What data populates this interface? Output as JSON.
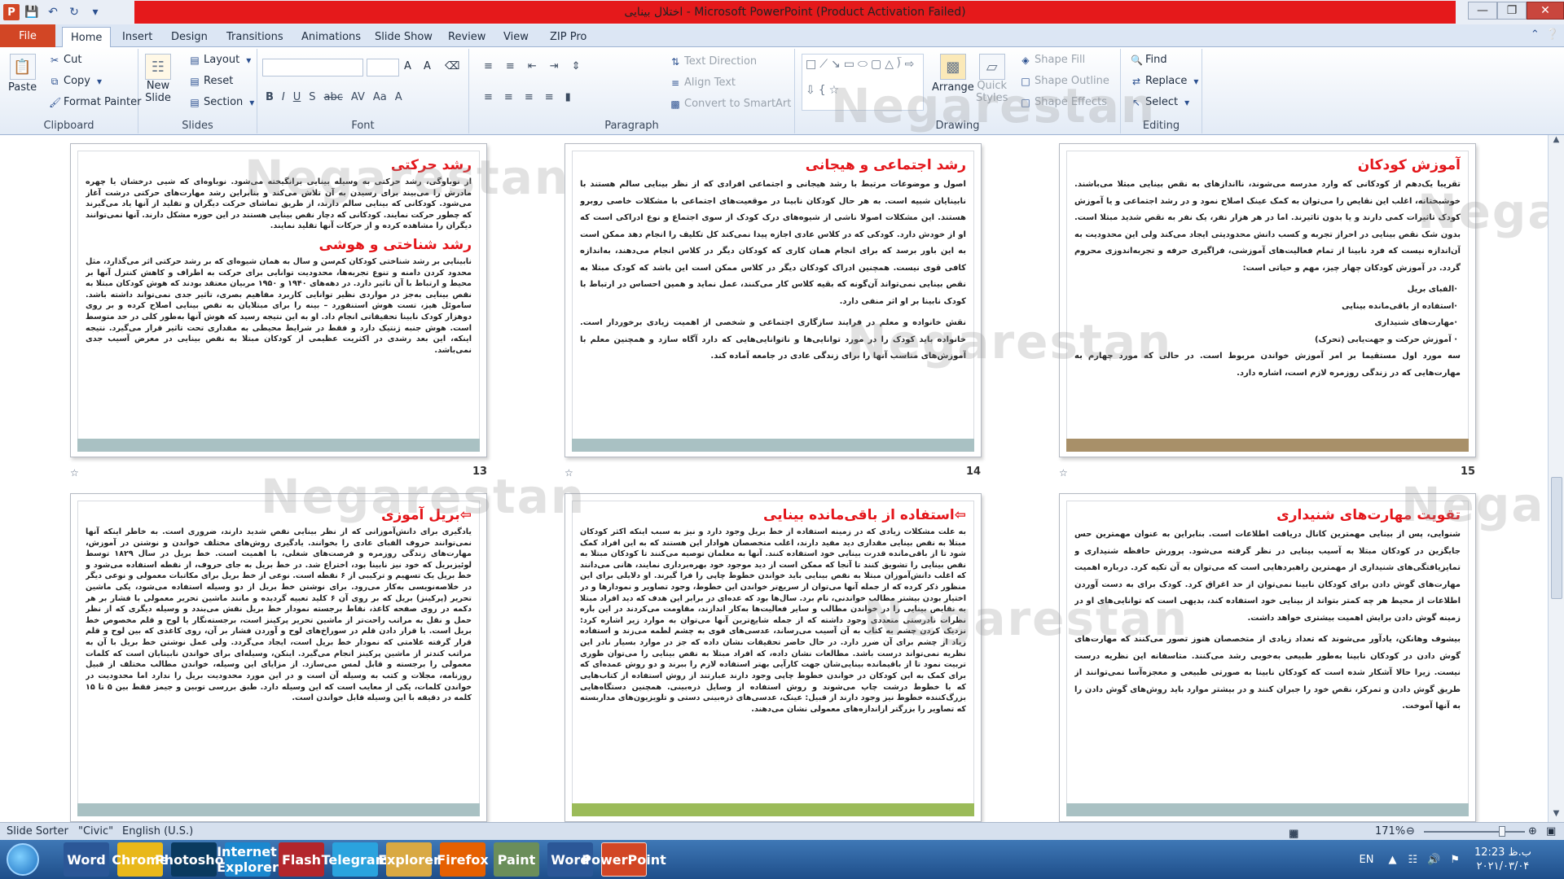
{
  "window": {
    "title": "اختلال بینایی  -  Microsoft PowerPoint (Product Activation Failed)",
    "app_letter": "P"
  },
  "ribbon_tabs": [
    {
      "label": "File"
    },
    {
      "label": "Home"
    },
    {
      "label": "Insert"
    },
    {
      "label": "Design"
    },
    {
      "label": "Transitions"
    },
    {
      "label": "Animations"
    },
    {
      "label": "Slide Show"
    },
    {
      "label": "Review"
    },
    {
      "label": "View"
    },
    {
      "label": "ZIP Pro"
    }
  ],
  "ribbon": {
    "clipboard": {
      "paste": "Paste",
      "cut": "Cut",
      "copy": "Copy",
      "format_painter": "Format Painter",
      "label": "Clipboard"
    },
    "slides": {
      "new_slide": "New",
      "new_slide2": "Slide",
      "layout": "Layout",
      "reset": "Reset",
      "section": "Section",
      "label": "Slides"
    },
    "font": {
      "label": "Font",
      "bold": "B",
      "italic": "I",
      "underline": "U",
      "shadow": "S",
      "strike": "abc",
      "spacing": "AV",
      "case": "Aa",
      "color": "A",
      "grow": "A",
      "shrink": "A"
    },
    "paragraph": {
      "label": "Paragraph",
      "text_direction": "Text Direction",
      "align_text": "Align Text",
      "convert_smartart": "Convert to SmartArt"
    },
    "drawing": {
      "label": "Drawing",
      "arrange": "Arrange",
      "quick_styles": "Quick",
      "quick_styles2": "Styles",
      "shape_fill": "Shape Fill",
      "shape_outline": "Shape Outline",
      "shape_effects": "Shape Effects"
    },
    "editing": {
      "label": "Editing",
      "find": "Find",
      "replace": "Replace",
      "select": "Select"
    }
  },
  "slides": [
    {
      "number": "13",
      "footer_color": "#a9c1c3",
      "sections": [
        {
          "title": "رشد حرکتی",
          "text": "از نوباوگی، رشد حرکتی به وسیله بینایی برانگیخته می‌شود. نوباوه‌ای که شیی درخشان یا چهره مادرش را می‌بیند برای رسیدن به آن تلاش می‌کند و بنابراین رشد مهارت‌های حرکتی درشت آغاز می‌شود. کودکانی که بینایی سالم دارند، از طریق تماشای حرکت دیگران و تقلید از آنها یاد می‌گیرند که چطور حرکت نمایند. کودکانی که دچار نقص بینایی هستند در این حوزه مشکل دارند. آنها نمی‌توانند دیگران را مشاهده کرده و از حرکات آنها تقلید نمایند."
        },
        {
          "title": "رشد شناختی و هوشی",
          "text": "نابینایی بر رشد شناختی کودکان کم‌سن و سال به همان شیوه‌ای که بر رشد حرکتی اثر می‌گذارد، مثل محدود کردن دامنه و تنوع تجربه‌ها، محدودیت توانایی برای حرکت به اطراف و کاهش کنترل آنها بر محیط و ارتباط با آن تاثیر دارد. در دهه‌های ۱۹۴۰ و ۱۹۵۰ مربیان معتقد بودند که هوش کودکان مبتلا به نقص بینایی به‌جز در مواردی نظیر توانایی کاربرد مفاهیم بصری، تاثیر جدی نمی‌تواند داشته باشد. ساموئل هیز، تست هوش استنفورد – بینه را برای مبتلایان به نقص بینایی اصلاح کرده و بر روی دوهزار کودک نابینا تحقیقاتی انجام داد. او به این نتیجه رسید که هوش آنها به‌طور کلی در حد متوسط است. هوش جنبه ژنتیک دارد و فقط در شرایط محیطی به مقداری تحت تاثیر قرار می‌گیرد. نتیجه اینکه، این بعد رشدی در اکثریت عظیمی از کودکان مبتلا به نقص بینایی در معرض آسیب جدی نمی‌باشد."
        }
      ]
    },
    {
      "number": "14",
      "footer_color": "#a9c1c3",
      "sections": [
        {
          "title": "رشد اجتماعی و هیجانی",
          "text": "اصول و موضوعات مرتبط با رشد هیجانی و اجتماعی افرادی که از نظر بینایی سالم هستند با نابینایان شبیه است. به هر حال کودکان نابینا در موقعیت‌های اجتماعی با مشکلات خاصی روبرو هستند. این مشکلات اصولا ناشی از شیوه‌های درک کودک از سوی اجتماع و نوع ادراکی است که او از خودش دارد. کودکی که در کلاس عادی اجازه پیدا نمی‌کند کل تکلیف را انجام دهد ممکن است به این باور برسد که برای انجام همان کاری که کودکان دیگر در کلاس انجام می‌دهند، به‌اندازه کافی قوی نیست. همچنین ادراک کودکان دیگر در کلاس ممکن است این باشد که کودک مبتلا به نقص بینایی نمی‌تواند آن‌گونه که بقیه کلاس کار می‌کنند، عمل نماید و همین احساس در ارتباط با کودک نابینا بر او اثر منفی دارد."
        },
        {
          "title": "",
          "text": "نقش خانواده و معلم در فرایند سازگاری اجتماعی و شخصی از اهمیت زیادی برخوردار است. خانواده باید کودک را در مورد توانایی‌ها و ناتوانایی‌هایی که دارد آگاه سازد و همچنین معلم با آموزش‌های مناسب آنها را برای زندگی عادی در جامعه آماده کند."
        }
      ]
    },
    {
      "number": "15",
      "footer_color": "#a89069",
      "sections": [
        {
          "title": "آموزش کودکان",
          "text": "تقریبا یک‌دهم از کودکانی که وارد مدرسه می‌شوند، نااندازهای به نقص بینایی مبتلا می‌باشند. خوشبختانه، اغلب این نقایص را می‌توان به کمک عینک اصلاح نمود و در رشد اجتماعی و یا آموزش کودک تاثیرات کمی دارند و یا بدون تاثیرند. اما در هر هزار نفر، یک نفر به نقص شدید مبتلا است. بدون شک نقص بینایی در احراز تجربه و کسب دانش محدودیتی ایجاد می‌کند ولی این محدودیت به آن‌اندازه نیست که فرد نابینا از تمام فعالیت‌های آموزشی، فراگیری حرفه و تجربه‌اندوزی محروم گردد. در آموزش کودکان چهار چیز، مهم و حیاتی است:"
        }
      ],
      "list": [
        "·الفبای بریل",
        "·استفاده از باقی‌مانده بینایی",
        "·مهارت‌های شنیداری",
        "· آموزش حرکت و جهت‌یابی (تحرک)"
      ],
      "tail": "سه مورد اول مستقیما بر امر آموزش خواندن مربوط است. در حالی که مورد چهارم به مهارت‌هایی که در زندگی روزمره لازم است، اشاره دارد."
    },
    {
      "number": "",
      "footer_color": "#a9c1c3",
      "sections": [
        {
          "title": "بریل آموزی",
          "text": "یادگیری برای دانش‌آموزانی که از نظر بینایی نقص شدید دارند، ضروری است. به خاطر اینکه آنها نمی‌توانند حروف الفبای عادی را بخوانند. یادگیری روش‌های مختلف خواندن و نوشتن در آموزش، مهارت‌های زندگی روزمره و فرصت‌های شغلی، با اهمیت است. خط بریل در سال ۱۸۲۹ توسط لوئیزبریل که خود نیز نابینا بود، اختراع شد. در خط بریل به جای حروف، از نقطه استفاده می‌شود و خط بریل یک تسهیم و ترکیبی از ۶ نقطه است. نوعی از خط بریل برای مکاتبات معمولی و نوعی دیگر در خلاصه‌نویسی به‌کار می‌رود. برای نوشتن خط بریل از دو وسیله استفاده می‌شود، یکی ماشین تحریر (پرکینز) بریل که بر روی آن ۶ کلید تعبیه گردیده و مانند ماشین تحریر معمولی با فشار بر هر دکمه در روی صفحه کاغذ، نقاط برجسته نمودار خط بریل نقش می‌بندد و وسیله دیگری که از نظر حمل و نقل به مراتب راحت‌تر از ماشین تحریر پرکینز است، برجسته‌نگار یا لوح و قلم مخصوص خط بریل است. با قرار دادن قلم در سوراخ‌های لوح و آوردن فشار بر آن، روی کاغذی که بین لوح و قلم قرار گرفته علامتی که نمودار خط بریل است، ایجاد می‌گردد. ولی عمل نوشتن خط بریل با آن به مراتب کندتر از ماشین پرکینز انجام می‌گیرد. اینکن، وسیله‌ای برای خواندن نابینایان است که کلمات معمولی را برجسته و قابل لمس می‌سازد. از مزایای این وسیله، خواندن مطالب مختلف از قبیل روزنامه، مجلات و کتب به وسیله آن است و در این مورد محدودیت بریل را ندارد اما محدودیت در خواندن کلمات، یکی از معایب است که این وسیله دارد. طبق بررسی توبین و جیمز فقط بین ۵ تا ۱۵ کلمه در دقیقه با این وسیله قابل خواندن است."
        }
      ]
    },
    {
      "number": "",
      "footer_color": "#9bbb59",
      "sections": [
        {
          "title": "استفاده از باقی‌مانده بینایی",
          "text": "به علت مشکلات زیادی که در زمینه استفاده از خط بریل وجود دارد و نیز به سبب اینکه اکثر کودکان مبتلا به نقص بینایی مقداری دید مفید دارند، اغلب متخصصان هوادار این هستند که به این افراد کمک شود تا از باقی‌مانده قدرت بینایی خود استفاده کنند. آنها به معلمان توصیه می‌کنند تا کودکان مبتلا به نقص بینایی را تشویق کنند تا آنجا که ممکن است از دید موجود خود بهره‌برداری نمایند، هانی می‌دانند که اغلب دانش‌آموزان مبتلا به نقص بینایی باید خواندن خطوط چاپی را فرا گیرند. او دلایلی برای این منظور ذکر کرده که از جمله آنها می‌توان از سریع‌تر خواندن این خطوط، وجود تصاویر و نمودارها و در اختیار بودن بیشتر مطالب خواندنی، نام برد. سال‌ها بود که عده‌ای در برابر این هدف که دید افراد مبتلا به نقایص بینایی را در خواندن مطالب و سایر فعالیت‌ها به‌کار اندازند، مقاومت می‌کردند در این باره نظرات نادرستی متعددی وجود داشته که از جمله شایع‌ترین آنها می‌توان به موارد زیر اشاره کرد: نزدیک کردن چشم به کتاب به آن آسیب می‌رساند، عدسی‌های قوی به چشم لطمه می‌زند و استفاده زیاد از چشم برای آن ضرر دارد. در حال حاضر تحقیقات نشان داده که جز در موارد بسیار نادر این نظریه نمی‌تواند درست باشد. مطالعات نشان داده، که افراد مبتلا به نقص بینایی را می‌توان طوری تربیت نمود تا از باقیمانده بینایی‌شان جهت کارآیی بهتر استفاده لازم را ببرند و دو روش عمده‌ای که برای کمک به این کودکان در خواندن خطوط چاپی وجود دارند عبارتند از روش استفاده از کتاب‌هایی که با خطوط درشت چاپ می‌شوند و روش استفاده از وسایل ذره‌بینی. همچنین دستگاه‌هایی بزرگ‌کننده خطوط نیز وجود دارند از قبیل: عینک، عدسی‌های ذره‌بینی دستی و تلویزیون‌های مداربسته که تصاویر را بزرگتر ازاندازه‌های معمولی نشان می‌دهند."
        }
      ]
    },
    {
      "number": "",
      "footer_color": "#a9c1c3",
      "sections": [
        {
          "title": "تقویت مهارت‌های شنیداری",
          "text": "شنوایی، پس از بینایی مهمترین کانال دریافت اطلاعات است. بنابراین به عنوان مهمترین حس جایگزین در کودکان مبتلا به آسیب بینایی در نظر گرفته می‌شود. پرورش حافظه شنیداری و تمایزیافتگی‌های شنیداری از مهمترین راهبردهایی است که می‌توان به آن تکیه کرد. درباره اهمیت مهارت‌های گوش دادن برای کودکان نابینا نمی‌توان از حد اغراق کرد. کودک برای به دست آوردن اطلاعات از محیط هر چه کمتر بتواند از بینایی خود استفاده کند، بدیهی است که توانایی‌های او در زمینه گوش دادن برایش اهمیت بیشتری خواهد داشت."
        },
        {
          "title": "",
          "text": "بیشوف وهانکن، یادآور می‌شوند که تعداد زیادی از متخصصان هنوز تصور می‌کنند که مهارت‌های گوش دادن در کودکان نابینا به‌طور طبیعی به‌خوبی رشد می‌کنند. متاسفانه این نظریه درست نیست. زیرا حالا آشکار شده است که کودکان نابینا به صورتی طبیعی و معجزه‌آسا نمی‌توانند از طریق گوش دادن و تمرکز، نقص خود را جبران کنند و در بیشتر موارد باید روش‌های گوش دادن را به آنها آموخت."
        }
      ]
    }
  ],
  "watermark": {
    "text": "Negarestan"
  },
  "statusbar": {
    "view": "Slide Sorter",
    "theme": "\"Civic\"",
    "language": "English (U.S.)",
    "zoom": "171%"
  },
  "taskbar": {
    "apps": [
      "Word",
      "Chrome",
      "Photoshop",
      "Internet Explorer",
      "Flash",
      "Telegram",
      "Explorer",
      "Firefox",
      "Paint",
      "Word",
      "PowerPoint"
    ],
    "lang": "EN",
    "time": "12:23 ب.ظ",
    "date": "۲۰۲۱/۰۳/۰۴"
  }
}
